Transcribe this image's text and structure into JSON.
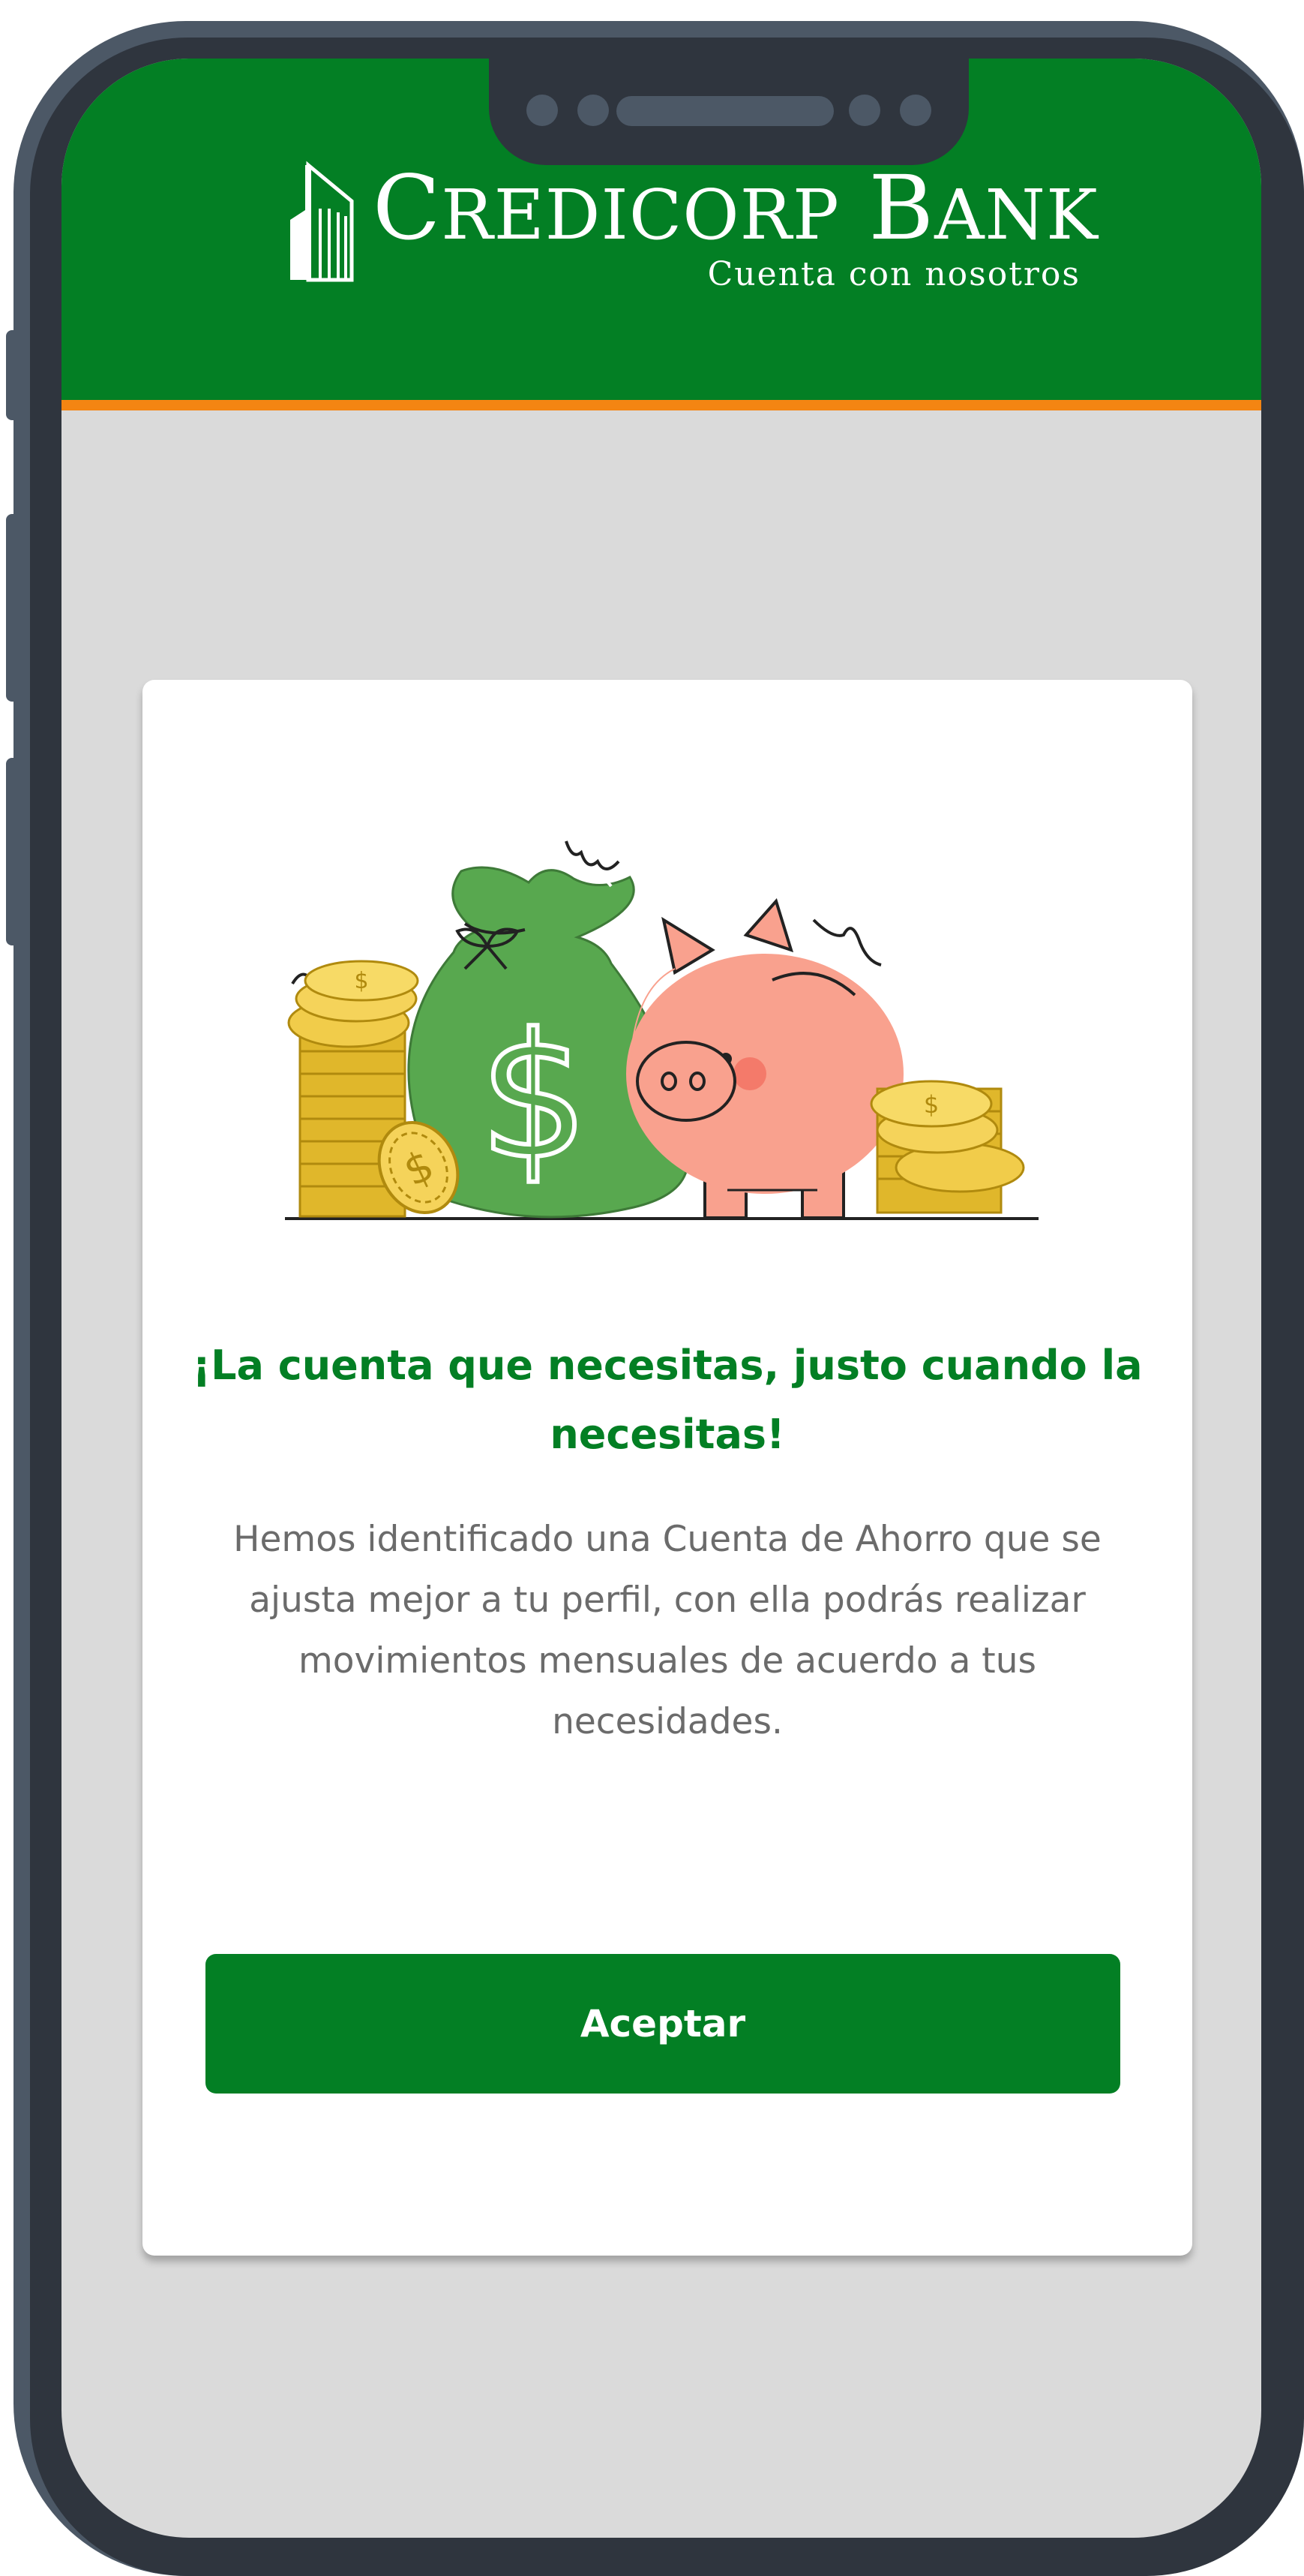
{
  "brand": {
    "name_first_cap": "C",
    "name_first_rest": "REDICORP",
    "name_second_cap": "B",
    "name_second_rest": "ANK",
    "tagline": "Cuenta con nosotros"
  },
  "modal": {
    "title": "¡La cuenta que necesitas, justo cuando la necesitas!",
    "body": "Hemos identificado una Cuenta de Ahorro que se ajusta mejor a tu perfil, con ella podrás realizar movimientos mensuales de acuerdo a tus necesidades.",
    "accept_label": "Aceptar",
    "illustration_icons": [
      "coin-stack-icon",
      "money-bag-icon",
      "dollar-sign-icon",
      "piggy-bank-icon",
      "coin-icon"
    ]
  },
  "colors": {
    "brand_green": "#037f24",
    "accent_orange": "#f48512",
    "screen_background": "#dadada",
    "text_gray": "#6b6b6b",
    "phone_frame": "#2f353e"
  }
}
